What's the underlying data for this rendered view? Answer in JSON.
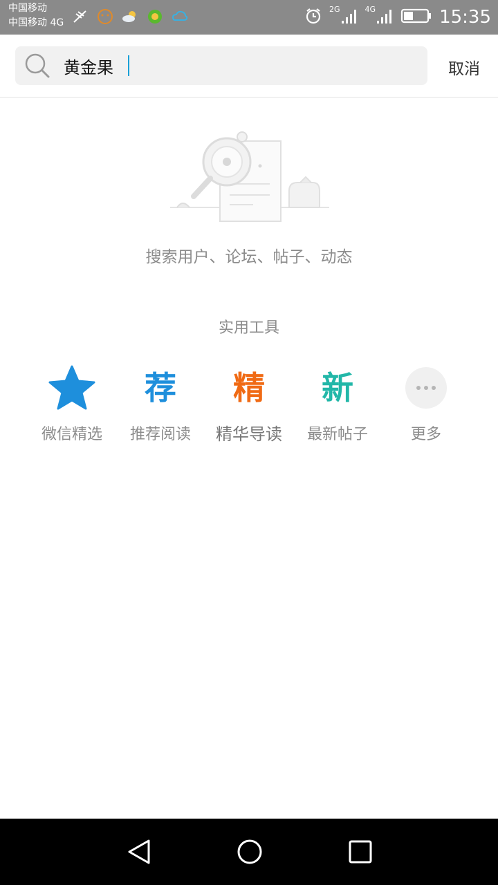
{
  "status": {
    "carrier_line1": "中国移动",
    "carrier_line2": "中国移动 4G",
    "net_2g": "2G",
    "net_4g": "4G",
    "time": "15:35"
  },
  "search": {
    "value": "黄金果",
    "cancel_label": "取消"
  },
  "empty_hint": "搜索用户、论坛、帖子、动态",
  "tools": {
    "title": "实用工具",
    "items": [
      {
        "label": "微信精选",
        "glyph": "",
        "icon": "star-icon",
        "color": "#1e8fdc"
      },
      {
        "label": "推荐阅读",
        "glyph": "荐",
        "icon": "recommend-icon",
        "color": "#1e8fdc"
      },
      {
        "label": "精华导读",
        "glyph": "精",
        "icon": "essence-icon",
        "color": "#f06a14"
      },
      {
        "label": "最新帖子",
        "glyph": "新",
        "icon": "new-icon",
        "color": "#22b7a8"
      },
      {
        "label": "更多",
        "glyph": "",
        "icon": "more-icon",
        "color": "#b5b5b5"
      }
    ]
  },
  "colors": {
    "status_bar": "#8a8a8a",
    "accent": "#1aa0d8",
    "nav_bar": "#000000"
  }
}
